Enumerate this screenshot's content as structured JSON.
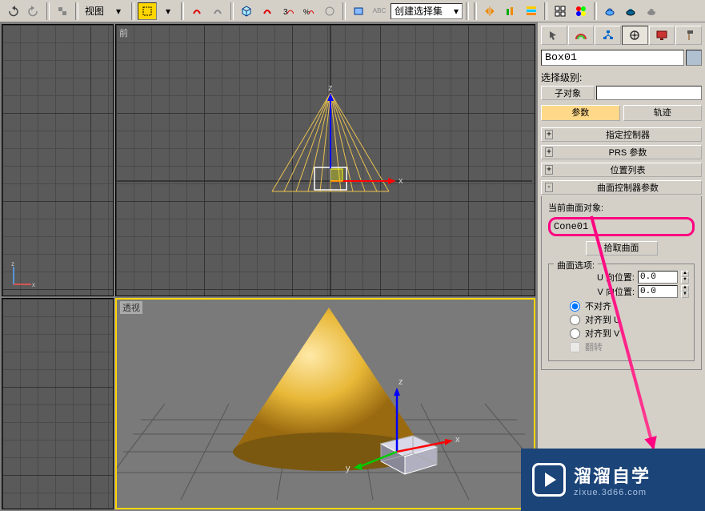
{
  "toolbar": {
    "view_label": "视图",
    "create_set_label": "创建选择集"
  },
  "viewports": {
    "front_label": "前",
    "perspective_label": "透视"
  },
  "panel": {
    "object_name": "Box01",
    "selection_level_label": "选择级别:",
    "sub_object_label": "子对象",
    "params_label": "参数",
    "trajectories_label": "轨迹",
    "rollouts": {
      "assign_controller": "指定控制器",
      "prs_params": "PRS 参数",
      "position_list": "位置列表",
      "surface_controller_params": "曲面控制器参数"
    },
    "surface": {
      "current_object_label": "当前曲面对象:",
      "current_object_value": "Cone01",
      "pick_surface_btn": "拾取曲面",
      "options_label": "曲面选项:",
      "u_position_label": "U 向位置:",
      "u_position_value": "0.0",
      "v_position_label": "V 向位置:",
      "v_position_value": "0.0",
      "align_none": "不对齐",
      "align_u": "对齐到 U",
      "align_v": "对齐到 V",
      "flip_label": "翻转"
    }
  },
  "watermark": {
    "main": "溜溜自学",
    "sub": "zixue.3d66.com"
  }
}
